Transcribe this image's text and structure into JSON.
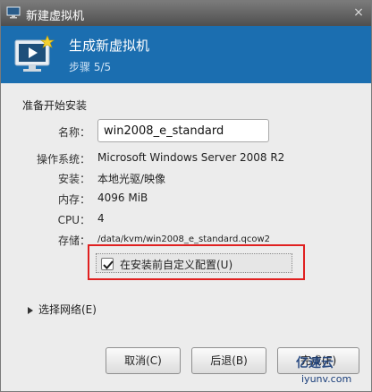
{
  "window": {
    "title": "新建虚拟机",
    "close_glyph": "×"
  },
  "header": {
    "title": "生成新虚拟机",
    "step": "步骤 5/5"
  },
  "section_title": "准备开始安装",
  "fields": {
    "name_label": "名称：",
    "name_value": "win2008_e_standard",
    "os_label": "操作系统：",
    "os_value": "Microsoft Windows Server 2008 R2",
    "install_label": "安装：",
    "install_value": "本地光驱/映像",
    "memory_label": "内存：",
    "memory_value": "4096 MiB",
    "cpu_label": "CPU：",
    "cpu_value": "4",
    "storage_label": "存储：",
    "storage_value": "/data/kvm/win2008_e_standard.qcow2"
  },
  "customize_checkbox": {
    "label": "在安装前自定义配置(U)",
    "checked": true
  },
  "network_expander": {
    "label": "选择网络(E)"
  },
  "buttons": {
    "cancel": "取消(C)",
    "back": "后退(B)",
    "finish": "完成(F)"
  },
  "watermark": {
    "text": "亿速云",
    "sub": "iyunv.com"
  },
  "colors": {
    "header_bg": "#1b6eb0",
    "highlight": "#e02020"
  }
}
